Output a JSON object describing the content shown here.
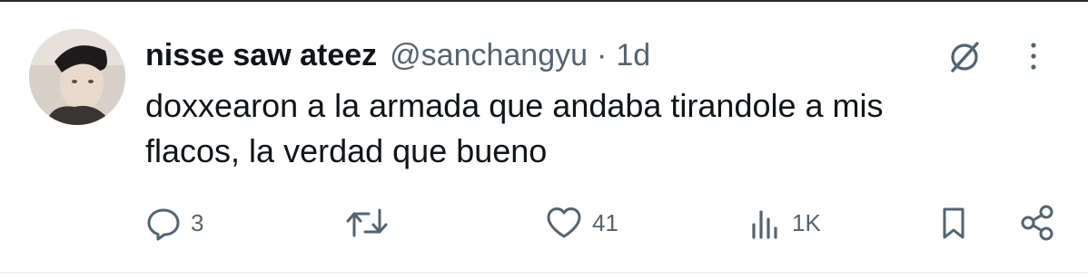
{
  "tweet": {
    "display_name": "nisse saw ateez",
    "handle": "@sanchangyu",
    "separator": "·",
    "time": "1d",
    "text_line1": "doxxearon a la armada que andaba tirandole a mis",
    "text_line2": "flacos, la verdad que bueno"
  },
  "actions": {
    "reply_count": "3",
    "like_count": "41",
    "view_count": "1K"
  },
  "icons": {
    "avatar": "avatar-photo",
    "grok": "grok-icon",
    "more": "more-vertical-icon",
    "reply": "reply-icon",
    "repost": "repost-icon",
    "like": "heart-icon",
    "views": "views-icon",
    "bookmark": "bookmark-icon",
    "share": "share-icon"
  },
  "colors": {
    "text": "#0f1419",
    "secondary": "#536471",
    "divider": "#eff3f4"
  }
}
